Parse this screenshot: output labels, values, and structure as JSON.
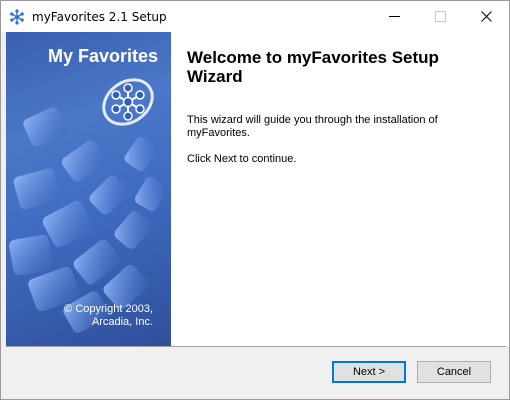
{
  "window": {
    "title": "myFavorites 2.1 Setup",
    "icon": "snowflake-network-icon",
    "controls": [
      "minimize-icon",
      "maximize-icon",
      "close-icon"
    ]
  },
  "banner": {
    "title": "My Favorites",
    "copyright_line1": "© Copyright 2003,",
    "copyright_line2": "Arcadia, Inc."
  },
  "content": {
    "heading": "Welcome to myFavorites Setup Wizard",
    "description": "This wizard will guide you through the installation of myFavorites.",
    "instruction": "Click Next to continue."
  },
  "buttons": {
    "next": "Next >",
    "cancel": "Cancel"
  },
  "colors": {
    "banner_blue": "#3f6cc0",
    "accent": "#0078d7"
  }
}
